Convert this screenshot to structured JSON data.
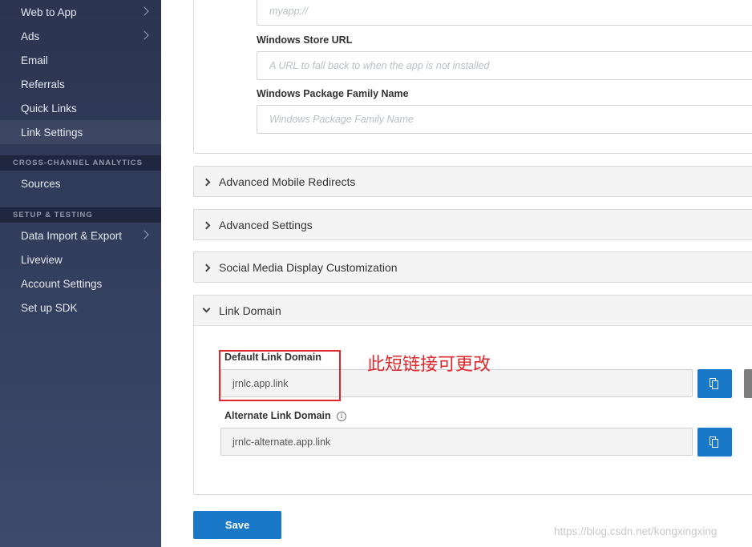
{
  "sidebar": {
    "items_top": [
      {
        "label": "Web to App",
        "has_chevron": true
      },
      {
        "label": "Ads",
        "has_chevron": true
      },
      {
        "label": "Email",
        "has_chevron": false
      },
      {
        "label": "Referrals",
        "has_chevron": false
      },
      {
        "label": "Quick Links",
        "has_chevron": false
      },
      {
        "label": "Link Settings",
        "has_chevron": false,
        "active": true
      }
    ],
    "section_analytics": "CROSS-CHANNEL ANALYTICS",
    "items_analytics": [
      {
        "label": "Sources"
      }
    ],
    "section_setup": "SETUP & TESTING",
    "items_setup": [
      {
        "label": "Data Import & Export",
        "has_chevron": true
      },
      {
        "label": "Liveview"
      },
      {
        "label": "Account Settings"
      },
      {
        "label": "Set up SDK"
      }
    ]
  },
  "windows_fields": {
    "uri_placeholder": "myapp://",
    "store_url_label": "Windows Store URL",
    "store_url_placeholder": "A URL to fall back to when the app is not installed",
    "package_label": "Windows Package Family Name",
    "package_placeholder": "Windows Package Family Name"
  },
  "accordions": [
    {
      "label": "Advanced Mobile Redirects",
      "expanded": false
    },
    {
      "label": "Advanced Settings",
      "expanded": false
    },
    {
      "label": "Social Media Display Customization",
      "expanded": false
    }
  ],
  "link_domain": {
    "header": "Link Domain",
    "expanded": true,
    "default_label": "Default Link Domain",
    "default_value": "jrnlc.app.link",
    "alternate_label": "Alternate Link Domain",
    "alternate_value": "jrnlc-alternate.app.link",
    "info_glyph": "i"
  },
  "annotation": {
    "text": "此短链接可更改",
    "color": "#e0272b"
  },
  "save_label": "Save",
  "watermark": "https://blog.csdn.net/kongxingxing",
  "colors": {
    "sidebar_bg": "#2b3450",
    "primary": "#1a78c8",
    "annotation_red": "#e0272b"
  }
}
